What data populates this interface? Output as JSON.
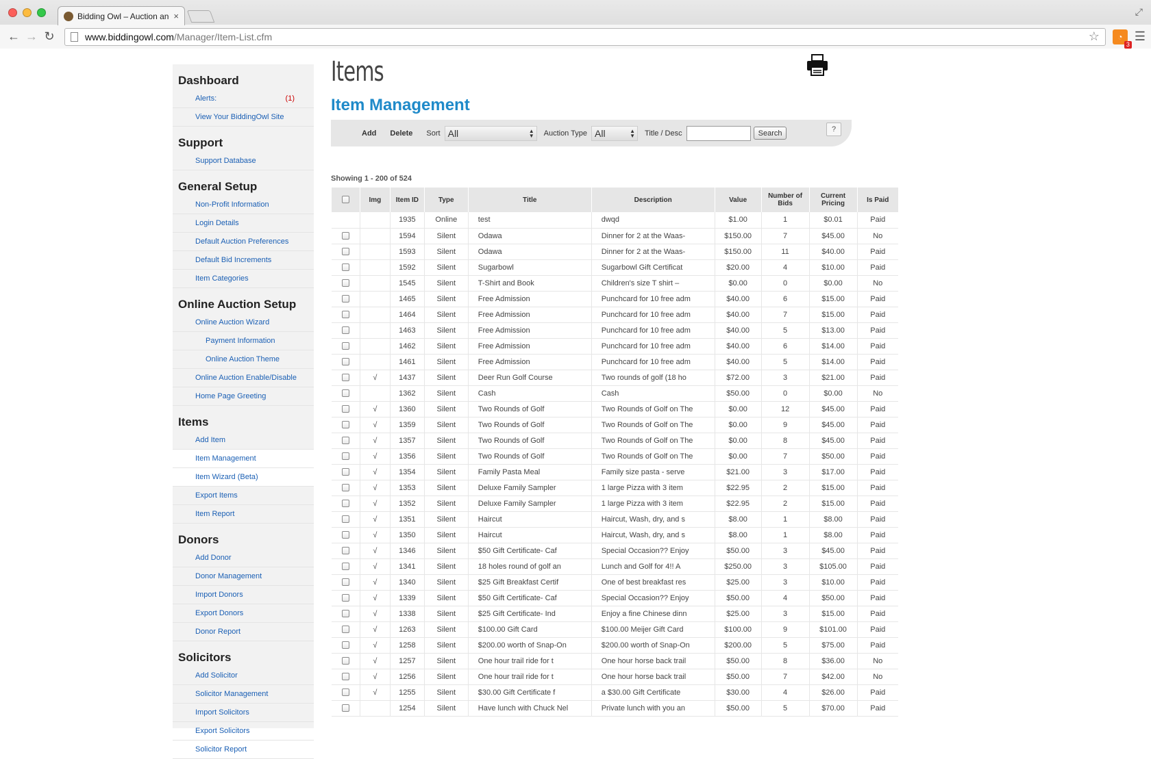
{
  "browser": {
    "tab_title": "Bidding Owl – Auction and",
    "tab_close": "×",
    "url_host": "www.biddingowl.com",
    "url_path": "/Manager/Item-List.cfm",
    "rss_badge": "3"
  },
  "sidebar": [
    {
      "heading": "Dashboard",
      "items": [
        {
          "label": "Alerts:",
          "count": "(1)"
        },
        {
          "label": "View Your BiddingOwl Site"
        }
      ]
    },
    {
      "heading": "Support",
      "items": [
        {
          "label": "Support Database"
        }
      ]
    },
    {
      "heading": "General Setup",
      "items": [
        {
          "label": "Non-Profit Information"
        },
        {
          "label": "Login Details"
        },
        {
          "label": "Default Auction Preferences"
        },
        {
          "label": "Default Bid Increments"
        },
        {
          "label": "Item Categories"
        }
      ]
    },
    {
      "heading": "Online Auction Setup",
      "items": [
        {
          "label": "Online Auction Wizard"
        },
        {
          "label": "Payment Information",
          "indent": true
        },
        {
          "label": "Online Auction Theme",
          "indent": true
        },
        {
          "label": "Online Auction Enable/Disable"
        },
        {
          "label": "Home Page Greeting"
        }
      ]
    },
    {
      "heading": "Items",
      "items": [
        {
          "label": "Add Item"
        },
        {
          "label": "Item Management",
          "active": true
        },
        {
          "label": "Item Wizard (Beta)",
          "active": true
        },
        {
          "label": "Export Items"
        },
        {
          "label": "Item Report"
        }
      ]
    },
    {
      "heading": "Donors",
      "items": [
        {
          "label": "Add Donor"
        },
        {
          "label": "Donor Management"
        },
        {
          "label": "Import Donors"
        },
        {
          "label": "Export Donors"
        },
        {
          "label": "Donor Report"
        }
      ]
    },
    {
      "heading": "Solicitors",
      "items": [
        {
          "label": "Add Solicitor"
        },
        {
          "label": "Solicitor Management"
        },
        {
          "label": "Import Solicitors"
        },
        {
          "label": "Export Solicitors"
        },
        {
          "label": "Solicitor Report"
        }
      ]
    }
  ],
  "main": {
    "page_title": "Items",
    "section_title": "Item Management",
    "filters": {
      "add_label": "Add",
      "delete_label": "Delete",
      "sort_label": "Sort",
      "sort_value": "All",
      "auction_type_label": "Auction Type",
      "auction_type_value": "All",
      "title_desc_label": "Title / Desc",
      "search_value": "",
      "search_button": "Search",
      "help_label": "?"
    },
    "showing": "Showing 1 - 200 of 524"
  },
  "table": {
    "columns": [
      "",
      "Img",
      "Item ID",
      "Type",
      "Title",
      "Description",
      "Value",
      "Number of Bids",
      "Current Pricing",
      "Is Paid"
    ],
    "rows": [
      {
        "cb": false,
        "img": "",
        "id": "1935",
        "type": "Online",
        "title": "test",
        "desc": "dwqd",
        "value": "$1.00",
        "bids": "1",
        "price": "$0.01",
        "paid": "Paid"
      },
      {
        "cb": true,
        "img": "",
        "id": "1594",
        "type": "Silent",
        "title": "Odawa",
        "desc": "Dinner for 2 at the Waas-",
        "value": "$150.00",
        "bids": "7",
        "price": "$45.00",
        "paid": "No"
      },
      {
        "cb": true,
        "img": "",
        "id": "1593",
        "type": "Silent",
        "title": "Odawa",
        "desc": "Dinner for 2 at the Waas-",
        "value": "$150.00",
        "bids": "11",
        "price": "$40.00",
        "paid": "Paid"
      },
      {
        "cb": true,
        "img": "",
        "id": "1592",
        "type": "Silent",
        "title": "Sugarbowl",
        "desc": "Sugarbowl Gift Certificat",
        "value": "$20.00",
        "bids": "4",
        "price": "$10.00",
        "paid": "Paid"
      },
      {
        "cb": true,
        "img": "",
        "id": "1545",
        "type": "Silent",
        "title": "T-Shirt and Book",
        "desc": "Children's size T shirt –",
        "value": "$0.00",
        "bids": "0",
        "price": "$0.00",
        "paid": "No"
      },
      {
        "cb": true,
        "img": "",
        "id": "1465",
        "type": "Silent",
        "title": "Free Admission",
        "desc": "Punchcard for 10 free adm",
        "value": "$40.00",
        "bids": "6",
        "price": "$15.00",
        "paid": "Paid"
      },
      {
        "cb": true,
        "img": "",
        "id": "1464",
        "type": "Silent",
        "title": "Free Admission",
        "desc": "Punchcard for 10 free adm",
        "value": "$40.00",
        "bids": "7",
        "price": "$15.00",
        "paid": "Paid"
      },
      {
        "cb": true,
        "img": "",
        "id": "1463",
        "type": "Silent",
        "title": "Free Admission",
        "desc": "Punchcard for 10 free adm",
        "value": "$40.00",
        "bids": "5",
        "price": "$13.00",
        "paid": "Paid"
      },
      {
        "cb": true,
        "img": "",
        "id": "1462",
        "type": "Silent",
        "title": "Free Admission",
        "desc": "Punchcard for 10 free adm",
        "value": "$40.00",
        "bids": "6",
        "price": "$14.00",
        "paid": "Paid"
      },
      {
        "cb": true,
        "img": "",
        "id": "1461",
        "type": "Silent",
        "title": "Free Admission",
        "desc": "Punchcard for 10 free adm",
        "value": "$40.00",
        "bids": "5",
        "price": "$14.00",
        "paid": "Paid"
      },
      {
        "cb": true,
        "img": "√",
        "id": "1437",
        "type": "Silent",
        "title": "Deer Run Golf Course",
        "desc": "Two rounds of golf (18 ho",
        "value": "$72.00",
        "bids": "3",
        "price": "$21.00",
        "paid": "Paid"
      },
      {
        "cb": true,
        "img": "",
        "id": "1362",
        "type": "Silent",
        "title": "Cash",
        "desc": "Cash",
        "value": "$50.00",
        "bids": "0",
        "price": "$0.00",
        "paid": "No"
      },
      {
        "cb": true,
        "img": "√",
        "id": "1360",
        "type": "Silent",
        "title": "Two Rounds of Golf",
        "desc": "Two Rounds of Golf on The",
        "value": "$0.00",
        "bids": "12",
        "price": "$45.00",
        "paid": "Paid"
      },
      {
        "cb": true,
        "img": "√",
        "id": "1359",
        "type": "Silent",
        "title": "Two Rounds of Golf",
        "desc": "Two Rounds of Golf on The",
        "value": "$0.00",
        "bids": "9",
        "price": "$45.00",
        "paid": "Paid"
      },
      {
        "cb": true,
        "img": "√",
        "id": "1357",
        "type": "Silent",
        "title": "Two Rounds of Golf",
        "desc": "Two Rounds of Golf on The",
        "value": "$0.00",
        "bids": "8",
        "price": "$45.00",
        "paid": "Paid"
      },
      {
        "cb": true,
        "img": "√",
        "id": "1356",
        "type": "Silent",
        "title": "Two Rounds of Golf",
        "desc": "Two Rounds of Golf on The",
        "value": "$0.00",
        "bids": "7",
        "price": "$50.00",
        "paid": "Paid"
      },
      {
        "cb": true,
        "img": "√",
        "id": "1354",
        "type": "Silent",
        "title": "Family Pasta Meal",
        "desc": "Family size pasta - serve",
        "value": "$21.00",
        "bids": "3",
        "price": "$17.00",
        "paid": "Paid"
      },
      {
        "cb": true,
        "img": "√",
        "id": "1353",
        "type": "Silent",
        "title": "Deluxe Family Sampler",
        "desc": "1 large Pizza with 3 item",
        "value": "$22.95",
        "bids": "2",
        "price": "$15.00",
        "paid": "Paid"
      },
      {
        "cb": true,
        "img": "√",
        "id": "1352",
        "type": "Silent",
        "title": "Deluxe Family Sampler",
        "desc": "1 large Pizza with 3 item",
        "value": "$22.95",
        "bids": "2",
        "price": "$15.00",
        "paid": "Paid"
      },
      {
        "cb": true,
        "img": "√",
        "id": "1351",
        "type": "Silent",
        "title": "Haircut",
        "desc": "Haircut, Wash, dry, and s",
        "value": "$8.00",
        "bids": "1",
        "price": "$8.00",
        "paid": "Paid"
      },
      {
        "cb": true,
        "img": "√",
        "id": "1350",
        "type": "Silent",
        "title": "Haircut",
        "desc": "Haircut, Wash, dry, and s",
        "value": "$8.00",
        "bids": "1",
        "price": "$8.00",
        "paid": "Paid"
      },
      {
        "cb": true,
        "img": "√",
        "id": "1346",
        "type": "Silent",
        "title": "$50 Gift Certificate- Caf",
        "desc": "Special Occasion?? Enjoy",
        "value": "$50.00",
        "bids": "3",
        "price": "$45.00",
        "paid": "Paid"
      },
      {
        "cb": true,
        "img": "√",
        "id": "1341",
        "type": "Silent",
        "title": "18 holes round of golf an",
        "desc": "Lunch and Golf for 4!! A",
        "value": "$250.00",
        "bids": "3",
        "price": "$105.00",
        "paid": "Paid"
      },
      {
        "cb": true,
        "img": "√",
        "id": "1340",
        "type": "Silent",
        "title": "$25 Gift Breakfast Certif",
        "desc": "One of best breakfast res",
        "value": "$25.00",
        "bids": "3",
        "price": "$10.00",
        "paid": "Paid"
      },
      {
        "cb": true,
        "img": "√",
        "id": "1339",
        "type": "Silent",
        "title": "$50 Gift Certificate- Caf",
        "desc": "Special Occasion?? Enjoy",
        "value": "$50.00",
        "bids": "4",
        "price": "$50.00",
        "paid": "Paid"
      },
      {
        "cb": true,
        "img": "√",
        "id": "1338",
        "type": "Silent",
        "title": "$25 Gift Certificate- Ind",
        "desc": "Enjoy a fine Chinese dinn",
        "value": "$25.00",
        "bids": "3",
        "price": "$15.00",
        "paid": "Paid"
      },
      {
        "cb": true,
        "img": "√",
        "id": "1263",
        "type": "Silent",
        "title": "$100.00 Gift Card",
        "desc": "$100.00 Meijer Gift Card",
        "value": "$100.00",
        "bids": "9",
        "price": "$101.00",
        "paid": "Paid"
      },
      {
        "cb": true,
        "img": "√",
        "id": "1258",
        "type": "Silent",
        "title": "$200.00 worth of Snap-On",
        "desc": "$200.00 worth of Snap-On",
        "value": "$200.00",
        "bids": "5",
        "price": "$75.00",
        "paid": "Paid"
      },
      {
        "cb": true,
        "img": "√",
        "id": "1257",
        "type": "Silent",
        "title": "One hour trail ride for t",
        "desc": "One hour horse back trail",
        "value": "$50.00",
        "bids": "8",
        "price": "$36.00",
        "paid": "No"
      },
      {
        "cb": true,
        "img": "√",
        "id": "1256",
        "type": "Silent",
        "title": "One hour trail ride for t",
        "desc": "One hour horse back trail",
        "value": "$50.00",
        "bids": "7",
        "price": "$42.00",
        "paid": "No"
      },
      {
        "cb": true,
        "img": "√",
        "id": "1255",
        "type": "Silent",
        "title": "$30.00 Gift Certificate f",
        "desc": "a $30.00 Gift Certificate",
        "value": "$30.00",
        "bids": "4",
        "price": "$26.00",
        "paid": "Paid"
      },
      {
        "cb": true,
        "img": "",
        "id": "1254",
        "type": "Silent",
        "title": "Have lunch with Chuck Nel",
        "desc": "Private lunch with you an",
        "value": "$50.00",
        "bids": "5",
        "price": "$70.00",
        "paid": "Paid"
      }
    ]
  }
}
